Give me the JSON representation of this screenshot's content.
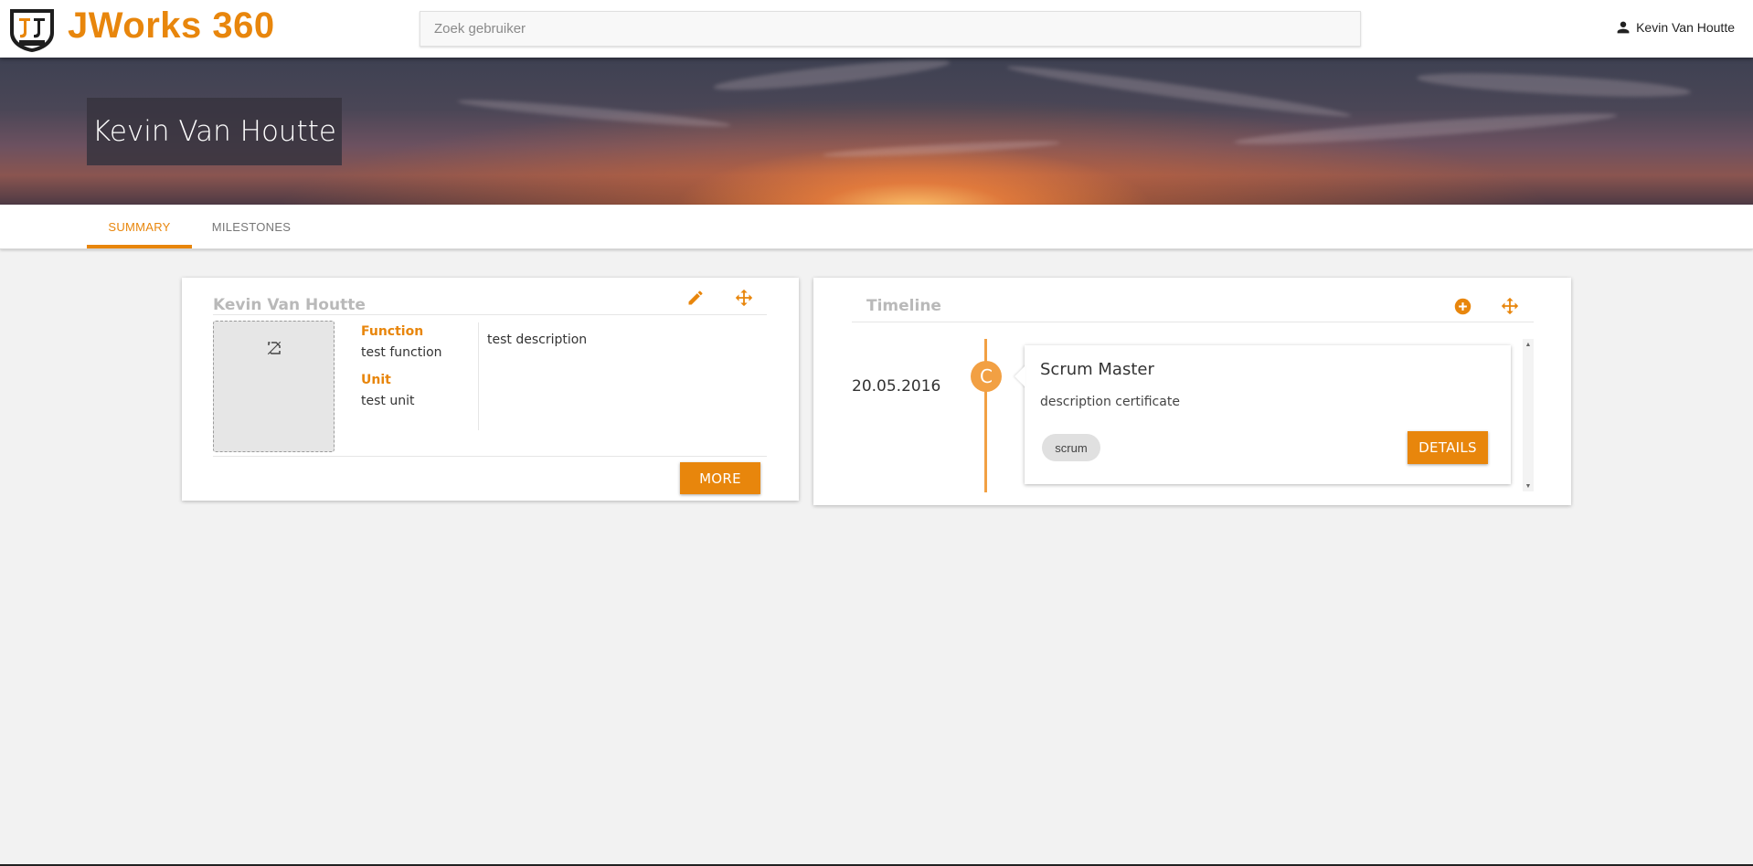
{
  "app": {
    "title": "JWorks 360",
    "logo_text": "JWORKS",
    "brand_color": "#e8860c"
  },
  "search": {
    "placeholder": "Zoek gebruiker",
    "value": ""
  },
  "user_menu": {
    "icon": "person-icon",
    "name": "Kevin Van Houtte"
  },
  "profile": {
    "name": "Kevin Van Houtte"
  },
  "tabs": [
    {
      "label": "SUMMARY",
      "active": true
    },
    {
      "label": "MILESTONES",
      "active": false
    }
  ],
  "summary_card": {
    "title": "Kevin Van Houtte",
    "edit_icon": "pencil-icon",
    "move_icon": "move-arrows-icon",
    "avatar_icon": "broken-image-icon",
    "function_label": "Function",
    "function_value": "test function",
    "unit_label": "Unit",
    "unit_value": "test unit",
    "description": "test description",
    "more_button": "MORE"
  },
  "timeline_card": {
    "title": "Timeline",
    "add_icon": "plus-circle-icon",
    "move_icon": "move-arrows-icon",
    "entries": [
      {
        "date": "20.05.2016",
        "badge": "C",
        "title": "Scrum Master",
        "description": "description certificate",
        "tags": [
          "scrum"
        ],
        "details_button": "DETAILS"
      }
    ]
  }
}
